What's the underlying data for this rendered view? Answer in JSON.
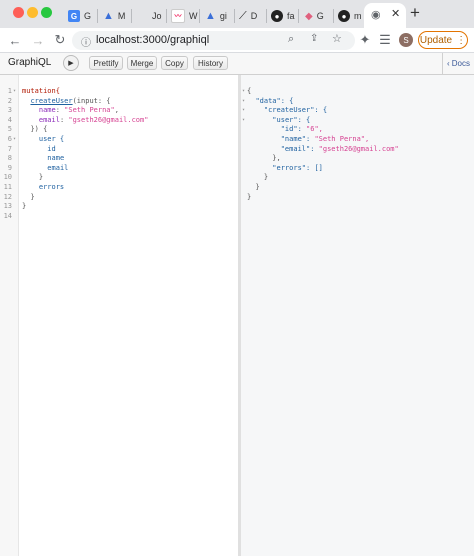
{
  "browser": {
    "tabs": [
      {
        "letter": "G",
        "label": "G",
        "color": "#4285f4"
      },
      {
        "letter": "M",
        "label": "M",
        "color": "#3b6fd8"
      },
      {
        "letter": "",
        "label": "Jo",
        "color": ""
      },
      {
        "letter": "W",
        "label": "W",
        "color": "#e8eaed"
      },
      {
        "letter": "gi",
        "label": "gi",
        "color": "#3b6fd8"
      },
      {
        "letter": "D",
        "label": "D",
        "color": "#222"
      },
      {
        "letter": "fa",
        "label": "fa",
        "color": "#222"
      },
      {
        "letter": "G",
        "label": "G",
        "color": "#e0607e"
      },
      {
        "letter": "m",
        "label": "m",
        "color": "#222"
      }
    ],
    "new_tab": "+",
    "url": "localhost:3000/graphiql",
    "profile_initial": "S",
    "update_label": "Update"
  },
  "graphiql": {
    "title": "GraphiQL",
    "buttons": [
      "Prettify",
      "Merge",
      "Copy",
      "History"
    ],
    "docs_label": "Docs"
  },
  "editor": {
    "line_numbers": [
      "1",
      "2",
      "3",
      "4",
      "5",
      "6",
      "7",
      "8",
      "9",
      "10",
      "11",
      "12",
      "13",
      "14"
    ],
    "lines": {
      "l1": "mutation{",
      "l2_fn": "createUser",
      "l2_rest": "(input: {",
      "l3_key": "name",
      "l3_val": "\"Seth Perna\"",
      "l4_key": "email",
      "l4_val": "\"gseth26@gmail.com\"",
      "l5": "}) {",
      "l6": "user {",
      "l7": "id",
      "l8": "name",
      "l9": "email",
      "l10": "}",
      "l11": "errors",
      "l12": "}",
      "l13": "}"
    }
  },
  "result": {
    "lines": {
      "r1": "{",
      "r2": "\"data\": {",
      "r3": "\"createUser\": {",
      "r4": "\"user\": {",
      "r5_key": "\"id\":",
      "r5_val": "\"6\",",
      "r6_key": "\"name\":",
      "r6_val": "\"Seth Perna\",",
      "r7_key": "\"email\":",
      "r7_val": "\"gseth26@gmail.com\"",
      "r8": "},",
      "r9": "\"errors\": []",
      "r10": "}",
      "r11": "}",
      "r12": "}"
    }
  }
}
